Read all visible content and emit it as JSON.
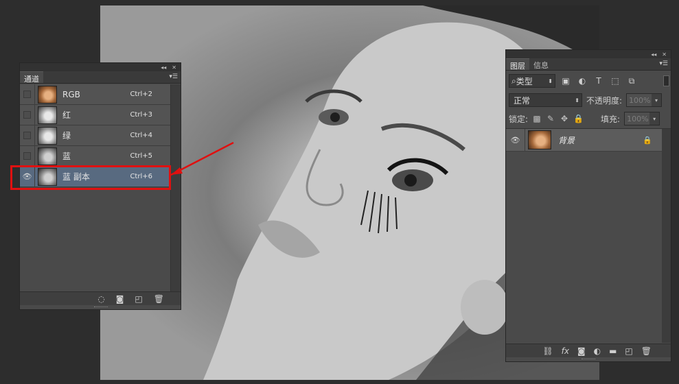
{
  "channels_panel": {
    "tab_label": "通道",
    "menu_icon": "panel-menu-icon",
    "rows": [
      {
        "name": "RGB",
        "shortcut": "Ctrl+2",
        "visible": false,
        "selected": false
      },
      {
        "name": "红",
        "shortcut": "Ctrl+3",
        "visible": false,
        "selected": false
      },
      {
        "name": "绿",
        "shortcut": "Ctrl+4",
        "visible": false,
        "selected": false
      },
      {
        "name": "蓝",
        "shortcut": "Ctrl+5",
        "visible": false,
        "selected": false
      },
      {
        "name": "蓝 副本",
        "shortcut": "Ctrl+6",
        "visible": true,
        "selected": true
      }
    ],
    "bottom_icons": [
      "load-selection-icon",
      "save-selection-icon",
      "new-channel-icon",
      "trash-icon"
    ]
  },
  "layers_panel": {
    "tabs": [
      "图层",
      "信息"
    ],
    "filter_label": "类型",
    "blend_mode": "正常",
    "opacity_label": "不透明度:",
    "opacity_value": "100%",
    "lock_label": "锁定:",
    "fill_label": "填充:",
    "fill_value": "100%",
    "layers": [
      {
        "name": "背景",
        "locked": true,
        "visible": true
      }
    ],
    "bottom_icons": [
      "link-icon",
      "fx-icon",
      "mask-icon",
      "adjustment-icon",
      "folder-icon",
      "new-layer-icon",
      "trash-icon"
    ]
  },
  "colors": {
    "selection_highlight": "#586a80",
    "annotation_red": "#e01010",
    "panel_bg": "#4a4a4a",
    "app_bg": "#2d2d2d"
  }
}
